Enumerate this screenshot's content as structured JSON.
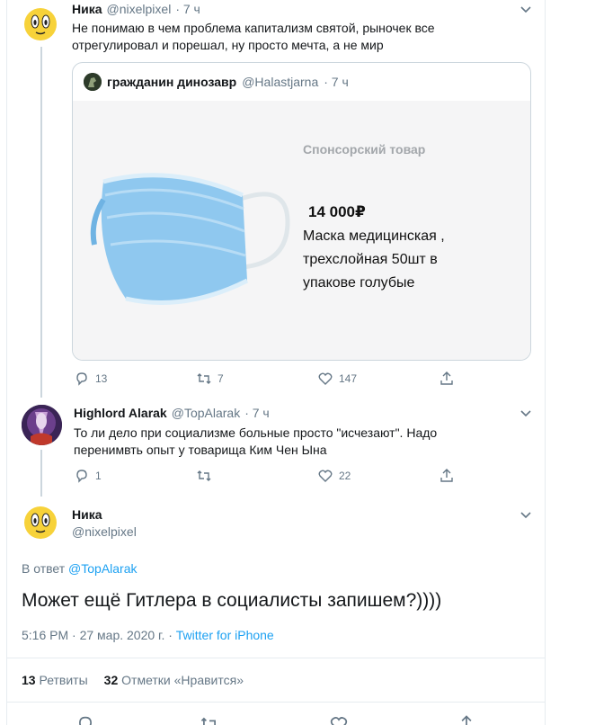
{
  "tweet1": {
    "name": "Ника",
    "handle": "@nixelpixel",
    "time": "· 7 ч",
    "text_line1": "Не понимаю в чем проблема капитализм святой, рыночек все",
    "text_line2": "отрегулировал и порешал, ну просто мечта, а не мир",
    "quote": {
      "name": "гражданин динозавр",
      "handle": "@Halastjarna",
      "time": "· 7 ч",
      "sponsored": "Спонсорский товар",
      "price": "14 000₽",
      "desc_line1": "Маска медицинская ,",
      "desc_line2": "трехслойная 50шт в",
      "desc_line3": "упакове голубые"
    },
    "replies": "13",
    "retweets": "7",
    "likes": "147"
  },
  "tweet2": {
    "name": "Highlord Alarak",
    "handle": "@TopAlarak",
    "time": "· 7 ч",
    "text_line1": "То ли дело при социализме больные просто \"исчезают\". Надо",
    "text_line2": "перенимвть опыт у товарища Ким Чен Ына",
    "replies": "1",
    "retweets": "",
    "likes": "22"
  },
  "main": {
    "name": "Ника",
    "handle": "@nixelpixel",
    "reply_to_prefix": "В ответ",
    "reply_to_handle": "@TopAlarak",
    "text": "Может ещё Гитлера в социалисты запишем?))))",
    "timestamp": "5:16 PM · 27 мар. 2020 г. · ",
    "source": "Twitter for iPhone",
    "retweet_count": "13",
    "retweet_label": "Ретвиты",
    "like_count": "32",
    "like_label": "Отметки «Нравится»"
  },
  "colors": {
    "accent": "#1da1f2",
    "secondary_text": "#657786",
    "border": "#e6ecf0"
  }
}
